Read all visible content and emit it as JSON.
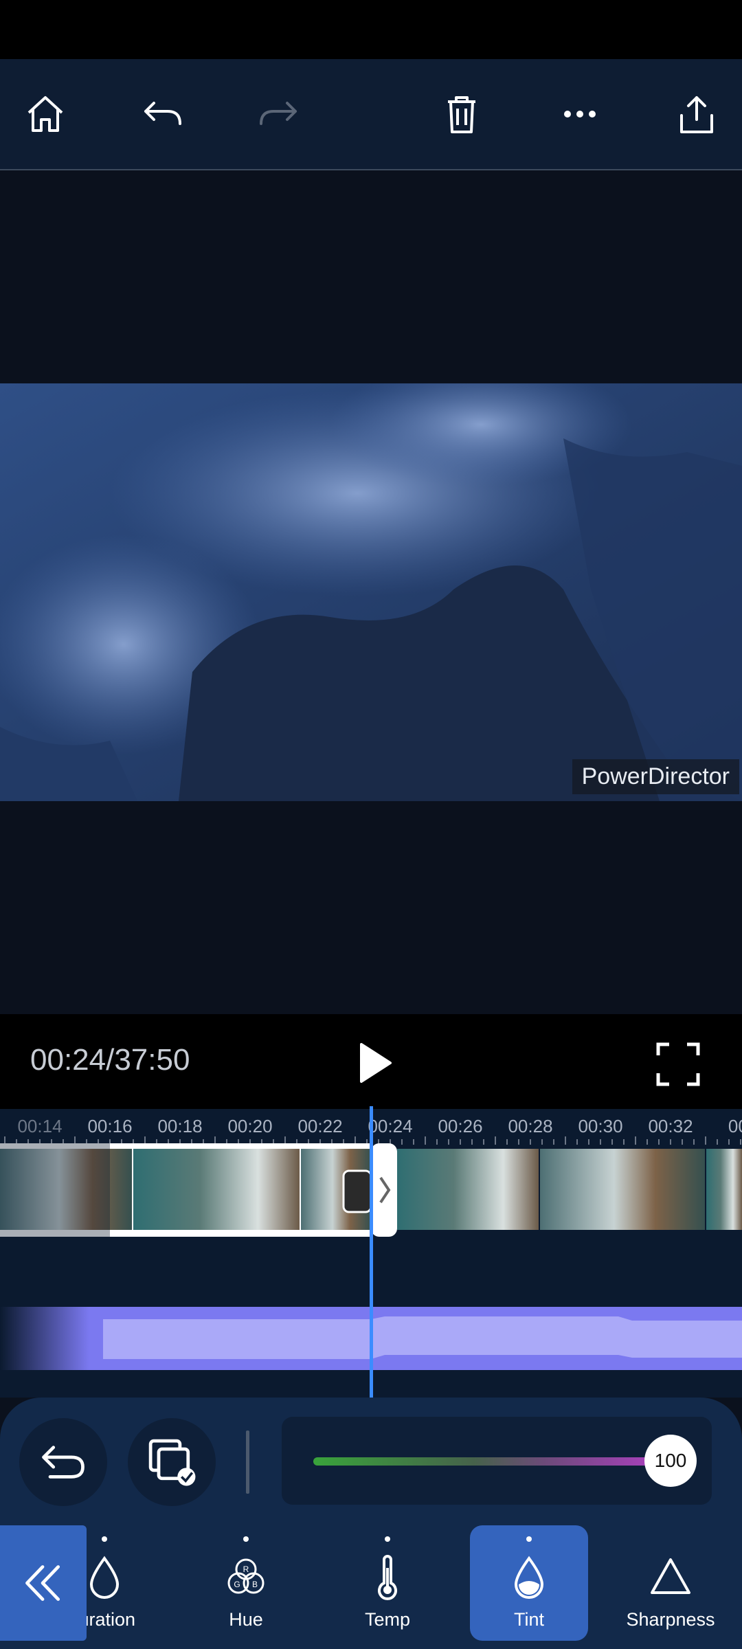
{
  "toolbar": {
    "home_icon": "home-icon",
    "undo_icon": "undo-icon",
    "redo_icon": "redo-icon",
    "delete_icon": "trash-icon",
    "more_icon": "more-icon",
    "export_icon": "export-icon"
  },
  "preview": {
    "watermark": "PowerDirector"
  },
  "playback": {
    "timecode": "00:24/37:50"
  },
  "timeline": {
    "ruler_labels": [
      "00:14",
      "00:16",
      "00:18",
      "00:20",
      "00:22",
      "00:24",
      "00:26",
      "00:28",
      "00:30",
      "00:32",
      "00:"
    ]
  },
  "adjust": {
    "value": "100",
    "slider_level": 1.0
  },
  "tabs": [
    {
      "label": "turation",
      "icon": "drop-icon"
    },
    {
      "label": "Hue",
      "icon": "rgb-icon"
    },
    {
      "label": "Temp",
      "icon": "thermometer-icon"
    },
    {
      "label": "Tint",
      "icon": "tint-drop-icon",
      "selected": true
    },
    {
      "label": "Sharpness",
      "icon": "triangle-icon"
    }
  ],
  "colors": {
    "accent": "#3464bd",
    "playhead": "#3b8cff",
    "audio_wave": "#a9a8f7"
  }
}
